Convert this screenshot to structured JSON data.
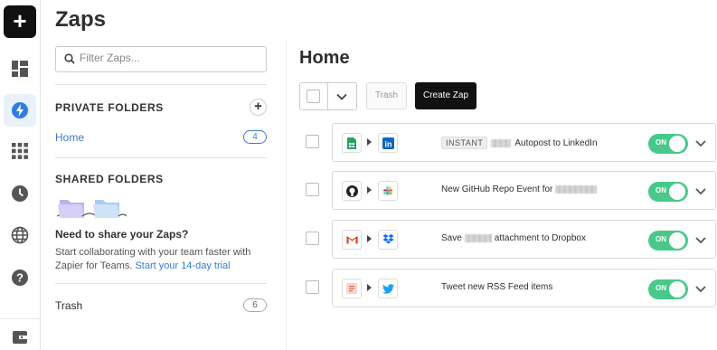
{
  "app": {
    "title": "Zaps"
  },
  "sidebar": {
    "search_placeholder": "Filter Zaps...",
    "private_title": "PRIVATE FOLDERS",
    "shared_title": "SHARED FOLDERS",
    "folders": [
      {
        "label": "Home",
        "count": "4"
      }
    ],
    "share_heading": "Need to share your Zaps?",
    "share_text": "Start collaborating with your team faster with Zapier for Teams.",
    "share_link": "Start your 14-day trial",
    "trash": {
      "label": "Trash",
      "count": "6"
    }
  },
  "main": {
    "title": "Home",
    "trash_button": "Trash",
    "create_button": "Create Zap",
    "zaps": [
      {
        "badge": "INSTANT",
        "title": "Autopost to LinkedIn",
        "from_icon": "google-sheets-icon",
        "to_icon": "linkedin-icon",
        "toggle": "ON"
      },
      {
        "title": "New GitHub Repo Event for",
        "from_icon": "github-icon",
        "to_icon": "slack-icon",
        "toggle": "ON"
      },
      {
        "title_pre": "Save",
        "title_post": "attachment to Dropbox",
        "from_icon": "gmail-icon",
        "to_icon": "dropbox-icon",
        "toggle": "ON"
      },
      {
        "title": "Tweet new RSS Feed items",
        "from_icon": "rss-icon",
        "to_icon": "twitter-icon",
        "toggle": "ON"
      }
    ]
  },
  "colors": {
    "accent": "#3a7bd5",
    "toggle_on": "#48c98a",
    "primary_button": "#111111"
  }
}
